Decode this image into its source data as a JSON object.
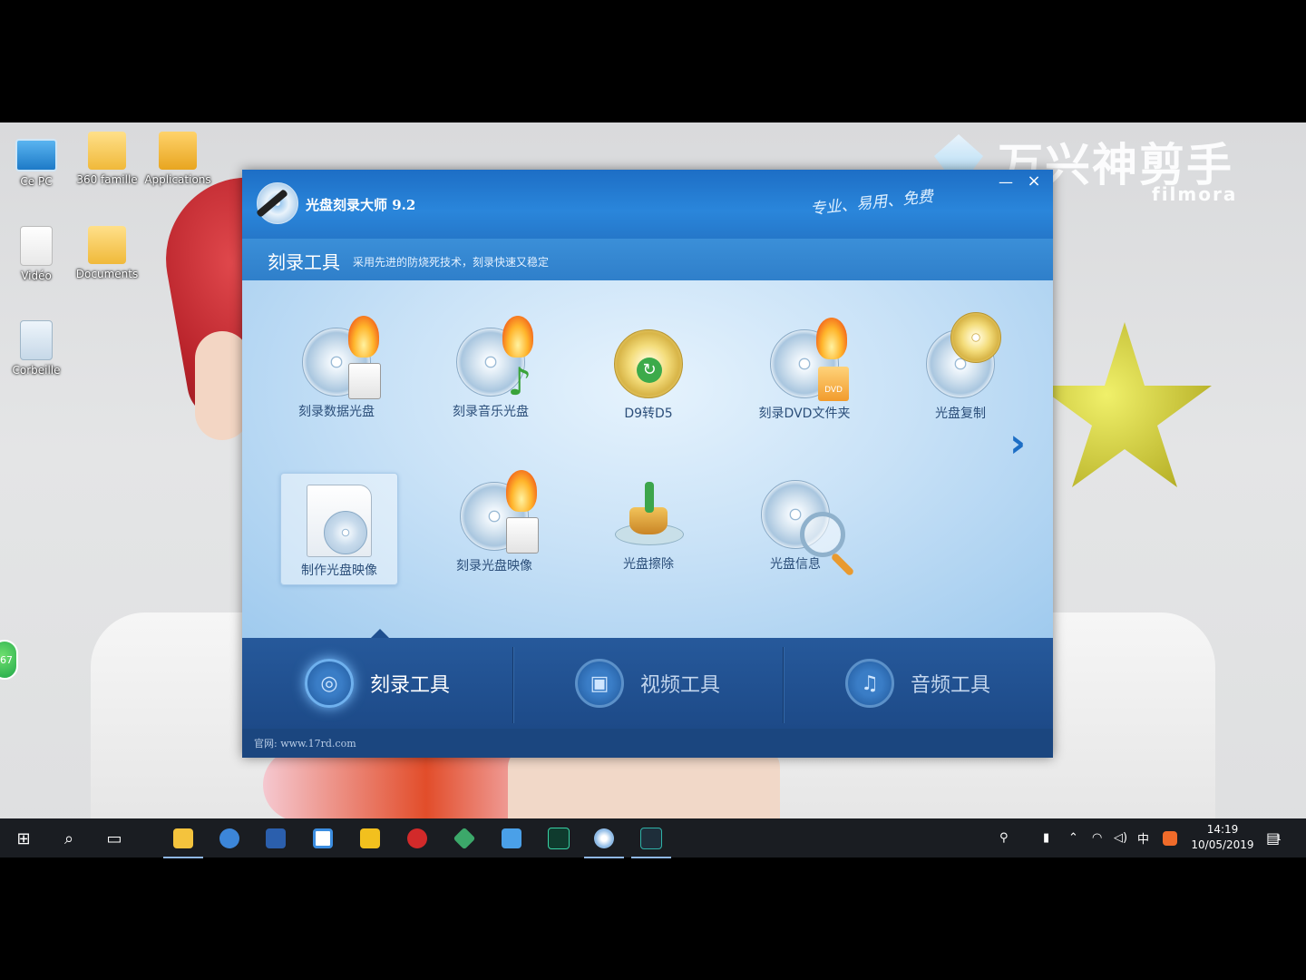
{
  "desktop": {
    "icons": [
      {
        "label": "Ce PC",
        "icon": "computer-icon"
      },
      {
        "label": "360 famille",
        "icon": "folder-icon"
      },
      {
        "label": "Applications",
        "icon": "folder-icon"
      },
      {
        "label": "Vidéo",
        "icon": "folder-icon"
      },
      {
        "label": "Documents",
        "icon": "folder-icon"
      },
      {
        "label": "Corbeille",
        "icon": "recycle-bin-icon"
      }
    ],
    "badge_value": "67"
  },
  "watermark": {
    "cn": "万兴神剪手",
    "en": "filmora"
  },
  "app": {
    "title": "光盘刻录大师 9.2",
    "slogan": "专业、易用、免费",
    "minimize": "—",
    "close": "×",
    "section_title": "刻录工具",
    "section_desc": "采用先进的防烧死技术，刻录快速又稳定",
    "tools": [
      {
        "label": "刻录数据光盘"
      },
      {
        "label": "刻录音乐光盘"
      },
      {
        "label": "D9转D5"
      },
      {
        "label": "刻录DVD文件夹",
        "badge": "DVD"
      },
      {
        "label": "光盘复制"
      },
      {
        "label": "制作光盘映像",
        "selected": true
      },
      {
        "label": "刻录光盘映像"
      },
      {
        "label": "光盘擦除"
      },
      {
        "label": "光盘信息"
      }
    ],
    "next_arrow": "›",
    "bottom_tabs": [
      {
        "label": "刻录工具",
        "icon": "disc-icon",
        "active": true
      },
      {
        "label": "视频工具",
        "icon": "film-icon",
        "active": false
      },
      {
        "label": "音频工具",
        "icon": "music-icon",
        "active": false
      }
    ],
    "footer": "官网: www.17rd.com"
  },
  "taskbar": {
    "apps": [
      "start-icon",
      "search-icon",
      "task-view-icon",
      "file-explorer-icon",
      "browser-icon",
      "word-icon",
      "baidu-icon",
      "player-icon",
      "netease-music-icon",
      "gem-icon",
      "media-icon",
      "audition-icon",
      "disc-burner-icon",
      "filmora-icon"
    ],
    "ime": "中",
    "time": "14:19",
    "date": "10/05/2019",
    "notif_count": "1"
  }
}
